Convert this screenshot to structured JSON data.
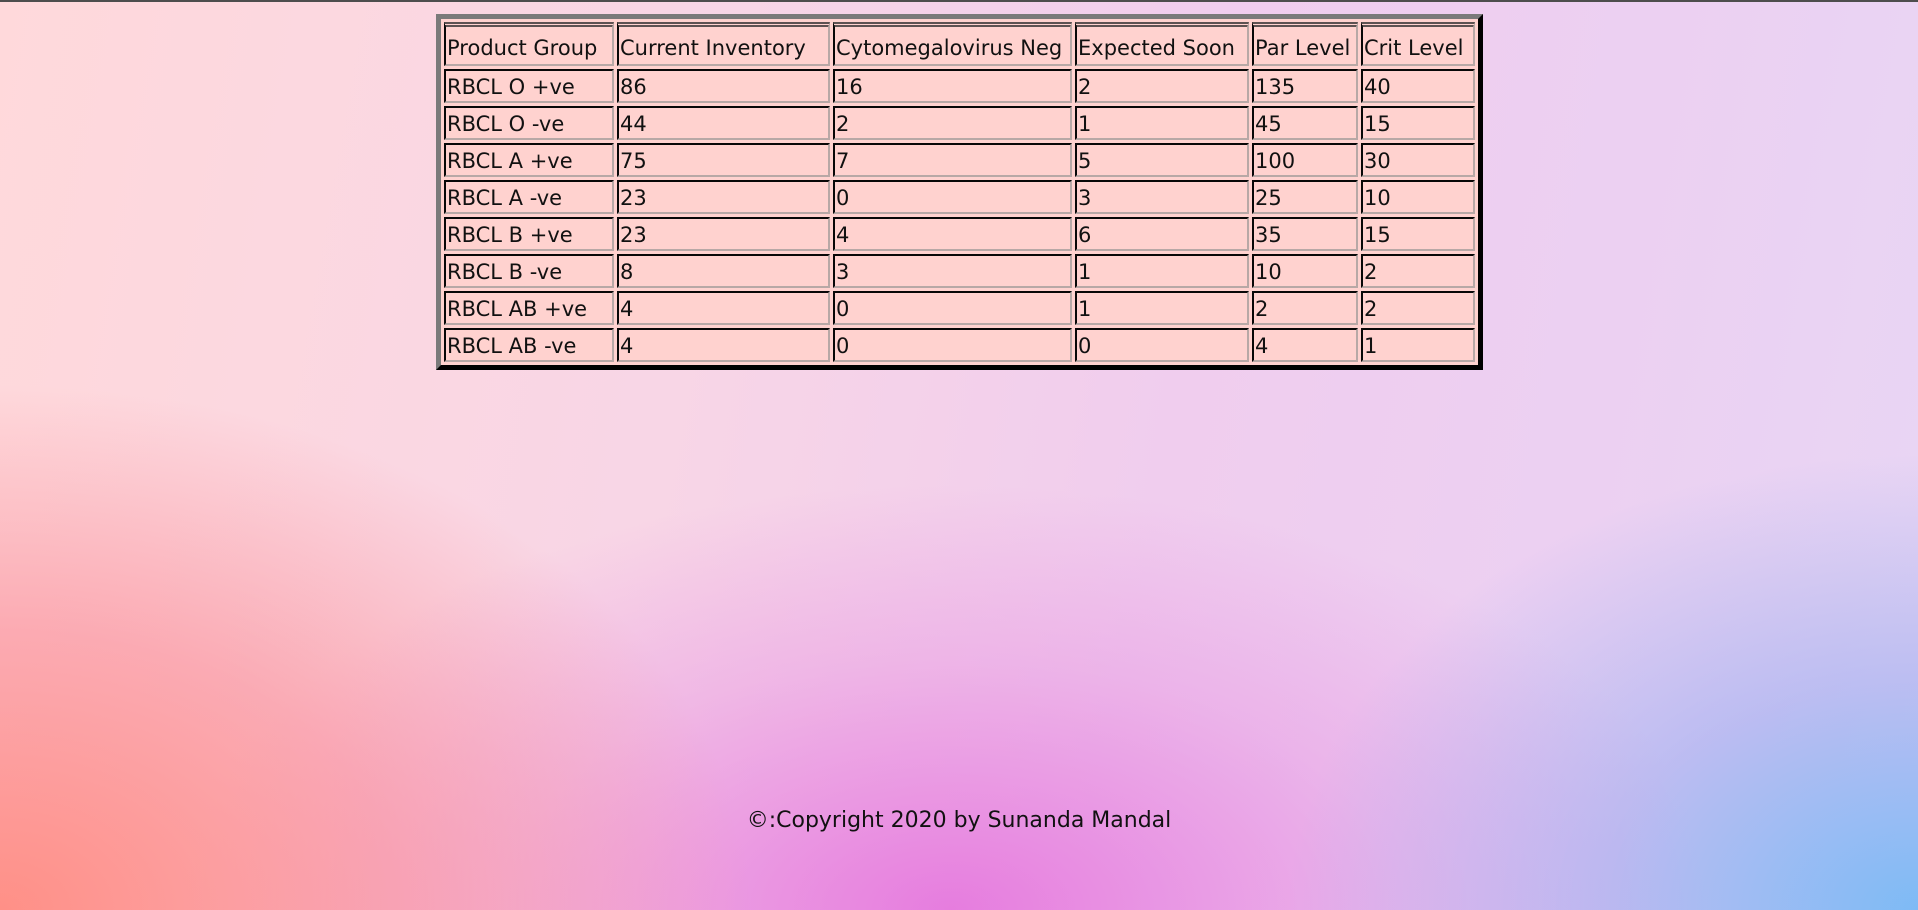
{
  "table": {
    "headers": [
      "Product Group",
      "Current Inventory",
      "Cytomegalovirus Neg",
      "Expected Soon",
      "Par Level",
      "Crit Level"
    ],
    "rows": [
      [
        "RBCL O +ve",
        "86",
        "16",
        "2",
        "135",
        "40"
      ],
      [
        "RBCL O -ve",
        "44",
        "2",
        "1",
        "45",
        "15"
      ],
      [
        "RBCL A +ve",
        "75",
        "7",
        "5",
        "100",
        "30"
      ],
      [
        "RBCL A -ve",
        "23",
        "0",
        "3",
        "25",
        "10"
      ],
      [
        "RBCL B +ve",
        "23",
        "4",
        "6",
        "35",
        "15"
      ],
      [
        "RBCL B -ve",
        "8",
        "3",
        "1",
        "10",
        "2"
      ],
      [
        "RBCL AB +ve",
        "4",
        "0",
        "1",
        "2",
        "2"
      ],
      [
        "RBCL AB -ve",
        "4",
        "0",
        "0",
        "4",
        "1"
      ]
    ]
  },
  "footer": {
    "copyright": "©:Copyright 2020 by Sunanda Mandal"
  },
  "colors": {
    "table_background": "#ffd2cf",
    "border": "#5d5252"
  }
}
